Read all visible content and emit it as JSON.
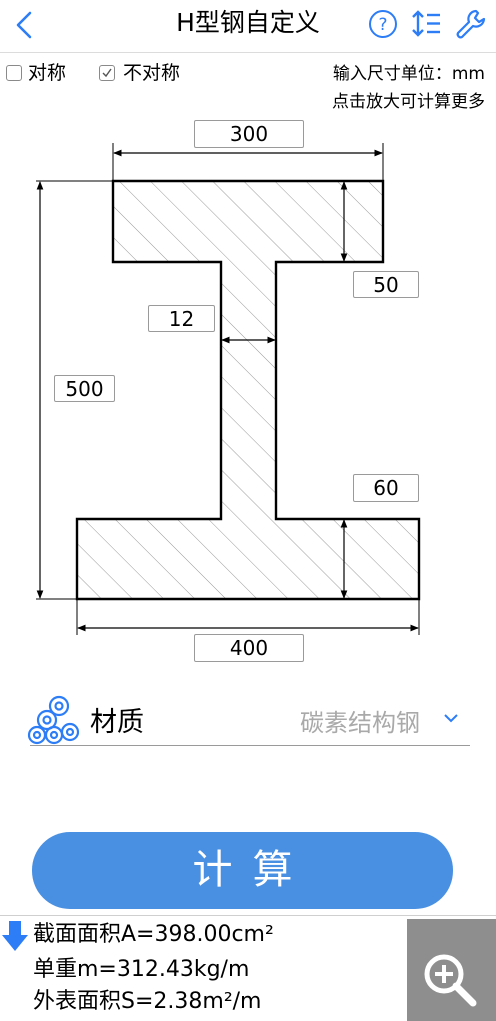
{
  "header": {
    "title": "H型钢自定义",
    "icons": [
      "back-chevron-icon",
      "help-icon",
      "sort-icon",
      "wrench-icon"
    ]
  },
  "options": {
    "symmetric_label": "对称",
    "symmetric_checked": false,
    "asymmetric_label": "不对称",
    "asymmetric_checked": true,
    "unit_label": "输入尺寸单位：mm",
    "zoom_hint": "点击放大可计算更多"
  },
  "dimensions": {
    "top_flange_width": "300",
    "top_flange_thickness": "50",
    "web_thickness": "12",
    "total_height": "500",
    "bottom_flange_thickness": "60",
    "bottom_flange_width": "400"
  },
  "material": {
    "label": "材质",
    "value": "碳素结构钢"
  },
  "actions": {
    "calculate_label": "计算"
  },
  "results": {
    "area": "截面面积A=398.00cm²",
    "unit_weight": "单重m=312.43kg/m",
    "surface_area": "外表面积S=2.38m²/m"
  },
  "colors": {
    "accent": "#2d7df6",
    "button": "#4a90e2",
    "zoom_panel": "#8e8e8e"
  }
}
